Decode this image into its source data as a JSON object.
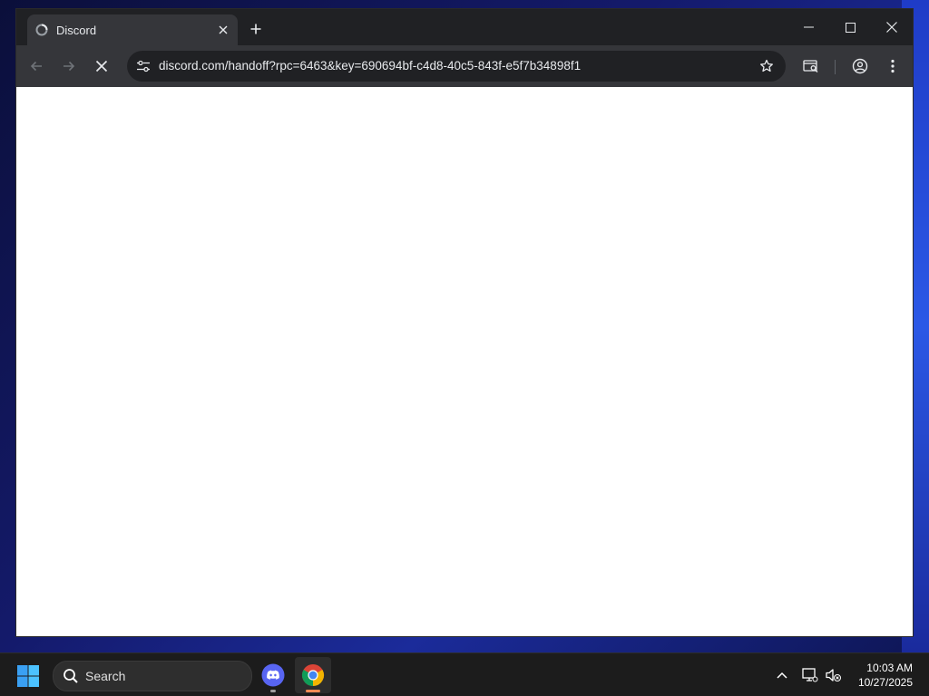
{
  "browser": {
    "tab": {
      "title": "Discord",
      "favicon": "discord-loading-icon"
    },
    "address_bar": {
      "url": "discord.com/handoff?rpc=6463&key=690694bf-c4d8-40c5-843f-e5f7b34898f1"
    },
    "state": "loading",
    "colors": {
      "titlebar": "#202124",
      "toolbar": "#35363a",
      "omnibox": "#202124",
      "text": "#e8eaed"
    }
  },
  "taskbar": {
    "search_label": "Search",
    "apps": [
      {
        "name": "Discord",
        "icon": "discord-icon",
        "running": true
      },
      {
        "name": "Google Chrome",
        "icon": "chrome-icon",
        "running": true,
        "active": true
      }
    ],
    "clock": {
      "time": "10:03 AM",
      "date": "10/27/2025"
    },
    "colors": {
      "background": "#1c1c1c",
      "active_indicator": "#f28b54",
      "running_indicator": "#9e9e9e"
    }
  }
}
